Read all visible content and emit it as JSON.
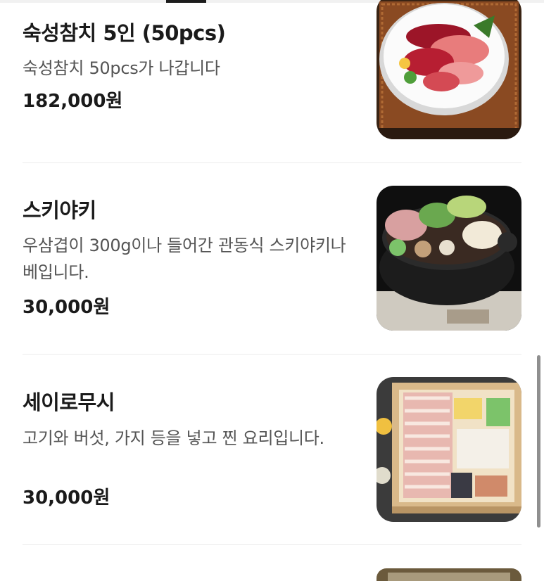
{
  "menu": {
    "items": [
      {
        "name": "숙성참치 5인 (50pcs)",
        "description": "숙성참치 50pcs가 나갑니다",
        "price": "182,000원",
        "image_icon": "tuna-sashimi-platter-photo"
      },
      {
        "name": "스키야키",
        "description": "우삼겹이 300g이나 들어간 관동식 스키야키나베입니다.",
        "price": "30,000원",
        "image_icon": "sukiyaki-hotpot-photo"
      },
      {
        "name": "세이로무시",
        "description": "고기와 버섯, 가지 등을 넣고 찐 요리입니다.",
        "price": "30,000원",
        "image_icon": "seiro-mushi-steamer-photo"
      }
    ]
  },
  "colors": {
    "text_primary": "#1a1a1a",
    "text_secondary": "#555555",
    "divider": "#ececec",
    "background": "#ffffff"
  }
}
